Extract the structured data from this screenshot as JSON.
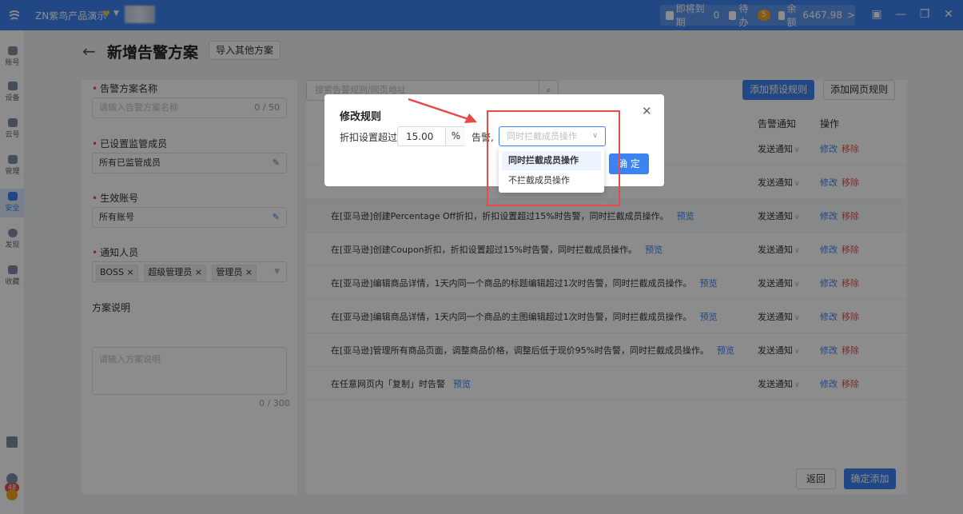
{
  "topbar": {
    "app_name": "ZN紫鸟产品演示",
    "expiring_label": "即将到期",
    "expiring_count": "0",
    "todo_label": "待办",
    "todo_count": "5",
    "balance_label": "余额",
    "balance_value": "6467.98",
    "balance_chevron": ">"
  },
  "sidebar": {
    "items": [
      {
        "label": "账号"
      },
      {
        "label": "设备"
      },
      {
        "label": "云号"
      },
      {
        "label": "管理"
      },
      {
        "label": "安全"
      },
      {
        "label": "发现"
      },
      {
        "label": "收藏"
      }
    ],
    "badge_count": "48"
  },
  "header": {
    "title": "新增告警方案",
    "import_label": "导入其他方案"
  },
  "form": {
    "name_label": "告警方案名称",
    "name_placeholder": "请输入告警方案名称",
    "name_counter": "0 / 50",
    "members_label": "已设置监管成员",
    "members_value": "所有已监管成员",
    "accounts_label": "生效账号",
    "accounts_value": "所有账号",
    "notify_label": "通知人员",
    "notify_tags": [
      "BOSS",
      "超级管理员",
      "管理员"
    ],
    "desc_label": "方案说明",
    "desc_placeholder": "请输入方案说明",
    "desc_counter": "0 / 300"
  },
  "rules": {
    "search_placeholder": "搜索告警规则/网页地址",
    "add_preset_label": "添加预设规则",
    "add_web_label": "添加网页规则",
    "col_notify": "告警通知",
    "col_action": "操作",
    "preview_label": "预览",
    "notify_value": "发送通知",
    "edit_label": "修改",
    "remove_label": "移除",
    "rows": [
      {
        "text": ""
      },
      {
        "text": ""
      },
      {
        "text": "在[亚马逊]创建Percentage Off折扣，折扣设置超过15%时告警，同时拦截成员操作。"
      },
      {
        "text": "在[亚马逊]创建Coupon折扣，折扣设置超过15%时告警，同时拦截成员操作。"
      },
      {
        "text": "在[亚马逊]编辑商品详情，1天内同一个商品的标题编辑超过1次时告警，同时拦截成员操作。"
      },
      {
        "text": "在[亚马逊]编辑商品详情，1天内同一个商品的主图编辑超过1次时告警，同时拦截成员操作。"
      },
      {
        "text": "在[亚马逊]管理所有商品页面，调整商品价格，调整后低于现价95%时告警，同时拦截成员操作。"
      },
      {
        "text": "在任意网页内「复制」时告警"
      }
    ]
  },
  "footer": {
    "back_label": "返回",
    "confirm_label": "确定添加"
  },
  "modal": {
    "title": "修改规则",
    "prefix_label": "折扣设置超过",
    "value": "15.00",
    "unit": "%",
    "suffix_label": "告警,",
    "select_placeholder": "同时拦截成员操作",
    "ok_label": "确 定",
    "options": [
      "同时拦截成员操作",
      "不拦截成员操作"
    ]
  },
  "colors": {
    "primary": "#3c83f0",
    "danger": "#f04b4b",
    "highlight_box": "#e84a4a"
  }
}
